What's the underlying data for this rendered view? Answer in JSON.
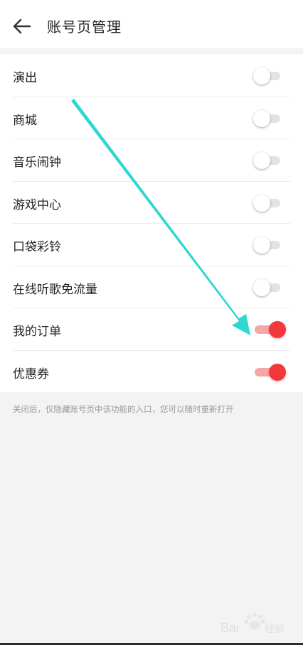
{
  "header": {
    "title": "账号页管理"
  },
  "items": [
    {
      "label": "演出",
      "on": false
    },
    {
      "label": "商城",
      "on": false
    },
    {
      "label": "音乐闹钟",
      "on": false
    },
    {
      "label": "游戏中心",
      "on": false
    },
    {
      "label": "口袋彩铃",
      "on": false
    },
    {
      "label": "在线听歌免流量",
      "on": false
    },
    {
      "label": "我的订单",
      "on": true
    },
    {
      "label": "优惠券",
      "on": true
    }
  ],
  "note": "关闭后，仅隐藏账号页中该功能的入口，您可以随时重新打开",
  "colors": {
    "toggle_on": "#f2373d",
    "toggle_on_track": "#f6a6a6",
    "toggle_off_track": "#e3e3e3",
    "annotation_arrow": "#2fd6d2"
  },
  "icons": {
    "back": "arrow-left-icon"
  },
  "watermark": "Baidu经验"
}
